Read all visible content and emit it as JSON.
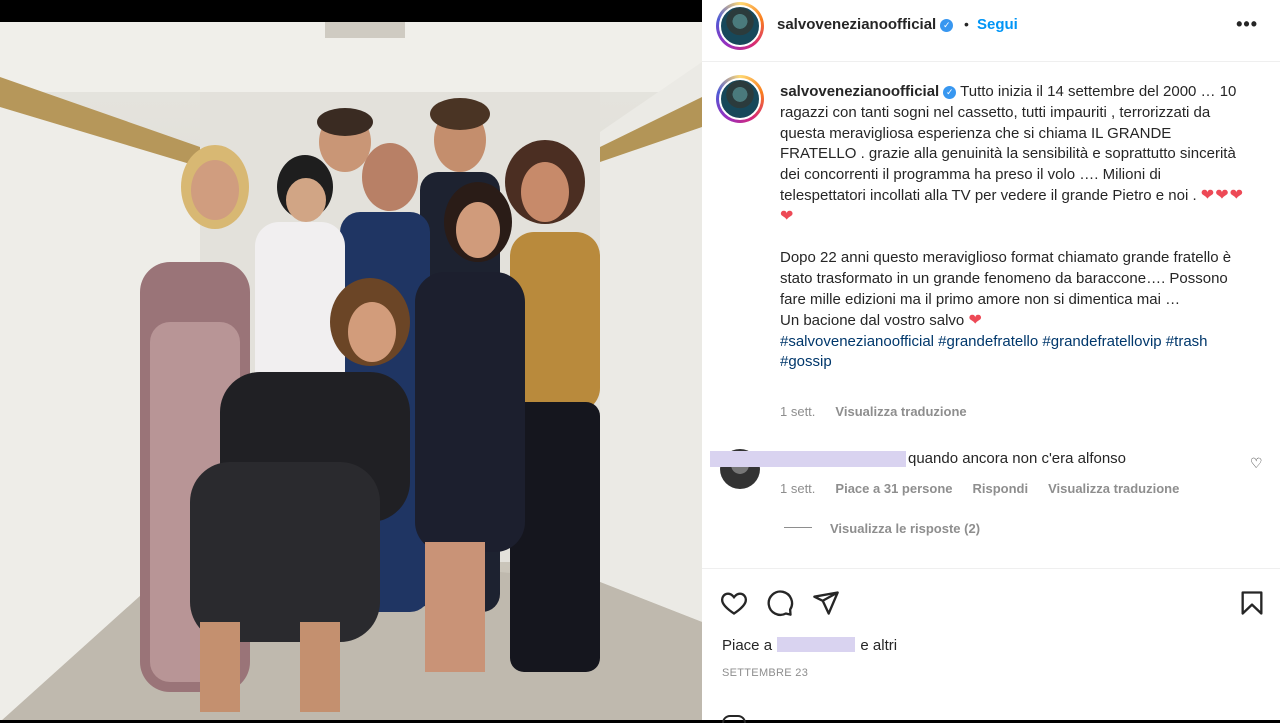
{
  "post": {
    "username": "salvovenezianoofficial",
    "follow_label": "Segui",
    "more_label": "•••",
    "separator": "•"
  },
  "caption": {
    "username": "salvovenezianoofficial",
    "paragraph1": "Tutto inizia il 14 settembre del 2000 … 10 ragazzi con tanti sogni nel cassetto, tutti impauriti , terrorizzati da questa meravigliosa esperienza che si chiama IL GRANDE FRATELLO . grazie alla genuinità la sensibilità e soprattutto sincerità dei concorrenti il programma ha preso il volo …. Milioni di telespettatori incollati alla TV per vedere il grande Pietro e noi .",
    "hearts1": "❤❤❤❤",
    "paragraph2": "Dopo 22 anni questo meraviglioso format chiamato grande fratello è stato trasformato in un grande fenomeno da baraccone…. Possono fare mille edizioni ma il primo amore non si dimentica mai …",
    "paragraph3": "Un bacione dal vostro salvo",
    "hearts2": "❤",
    "hashtags": "#salvovenezianoofficial #grandefratello #grandefratellovip #trash #gossip",
    "time": "1 sett.",
    "translate": "Visualizza traduzione"
  },
  "comment": {
    "text": "quando ancora non c'era alfonso",
    "time": "1 sett.",
    "likes": "Piace a 31 persone",
    "reply": "Rispondi",
    "translate": "Visualizza traduzione",
    "view_replies": "Visualizza le risposte (2)"
  },
  "actions": {
    "icons": [
      "heart-icon",
      "comment-icon",
      "share-icon",
      "bookmark-icon"
    ],
    "likes_prefix": "Piace a",
    "likes_suffix": "e altri",
    "date": "SETTEMBRE 23"
  },
  "colors": {
    "link": "#0095f6",
    "hashtag": "#00376b",
    "muted": "#8e8e8e",
    "heart": "#ed4956",
    "redaction": "#d9d3f0"
  }
}
